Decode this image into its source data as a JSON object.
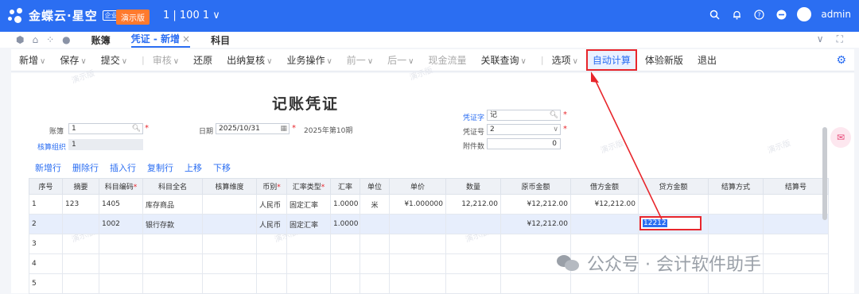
{
  "topbar": {
    "brand": "金蝶云·星空",
    "edition": "企业版",
    "demo_badge": "演示版",
    "org": "1 | 100 1 ∨",
    "user": "admin"
  },
  "tabs": [
    {
      "label": "账簿"
    },
    {
      "label": "凭证 - 新增"
    },
    {
      "label": "科目"
    }
  ],
  "toolbar": {
    "items": [
      "新增",
      "保存",
      "提交",
      "审核",
      "还原",
      "出纳复核",
      "业务操作",
      "前一",
      "后一",
      "现金流量",
      "关联查询",
      "选项",
      "自动计算",
      "体验新版",
      "退出"
    ]
  },
  "form": {
    "title": "记账凭证",
    "ledger_label": "账簿",
    "ledger_value": "1",
    "org_label": "核算组织",
    "org_value": "1",
    "date_label": "日期",
    "date_value": "2025/10/31",
    "period_text": "2025年第10期",
    "voucher_word_label": "凭证字",
    "voucher_word_value": "记",
    "voucher_no_label": "凭证号",
    "voucher_no_value": "2",
    "attach_label": "附件数",
    "attach_value": "0",
    "watermark": "演示版"
  },
  "entry_actions": [
    "新增行",
    "删除行",
    "插入行",
    "复制行",
    "上移",
    "下移"
  ],
  "grid": {
    "headers": [
      "序号",
      "摘要",
      "科目编码",
      "科目全名",
      "核算维度",
      "币别",
      "汇率类型",
      "汇率",
      "单位",
      "单价",
      "数量",
      "原币金额",
      "借方金额",
      "贷方金额",
      "结算方式",
      "结算号"
    ],
    "rows": [
      [
        "1",
        "123",
        "1405",
        "库存商品",
        "",
        "人民币",
        "固定汇率",
        "1.0000",
        "米",
        "¥1.000000",
        "12,212.00",
        "¥12,212.00",
        "¥12,212.00",
        "",
        "",
        ""
      ],
      [
        "2",
        "",
        "1002",
        "银行存款",
        "",
        "人民币",
        "固定汇率",
        "1.0000",
        "",
        "",
        "",
        "¥12,212.00",
        "",
        "12212",
        "",
        ""
      ],
      [
        "3",
        "",
        "",
        "",
        "",
        "",
        "",
        "",
        "",
        "",
        "",
        "",
        "",
        "",
        "",
        ""
      ],
      [
        "4",
        "",
        "",
        "",
        "",
        "",
        "",
        "",
        "",
        "",
        "",
        "",
        "",
        "",
        "",
        ""
      ],
      [
        "5",
        "",
        "",
        "",
        "",
        "",
        "",
        "",
        "",
        "",
        "",
        "",
        "",
        "",
        "",
        ""
      ]
    ]
  },
  "footer_watermark": "公众号 · 会计软件助手",
  "colors": {
    "brand": "#2b6ef2",
    "highlight": "#e8262c",
    "demo": "#ff7a2e"
  }
}
